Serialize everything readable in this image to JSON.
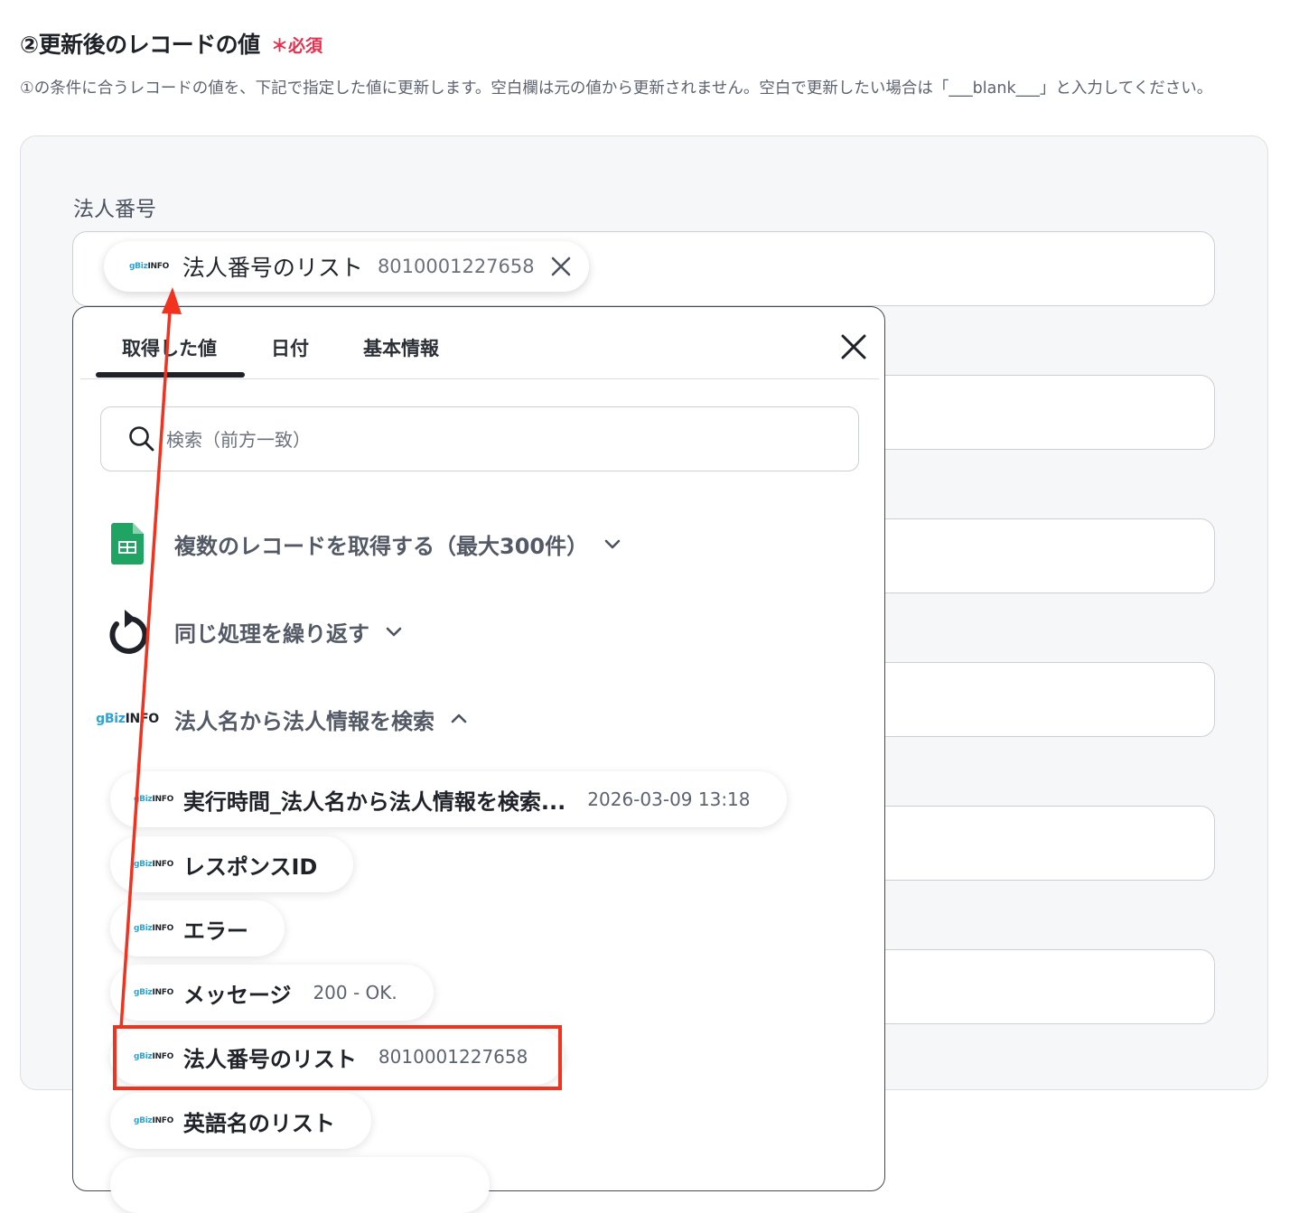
{
  "header": {
    "title": "②更新後のレコードの値",
    "required": "＊必須",
    "description": "①の条件に合うレコードの値を、下記で指定した値に更新します。空白欄は元の値から更新されません。空白で更新したい場合は「___blank___」と入力してください。"
  },
  "field": {
    "label": "法人番号",
    "chip_name": "法人番号のリスト",
    "chip_value": "8010001227658"
  },
  "panel": {
    "tabs": [
      "取得した値",
      "日付",
      "基本情報"
    ],
    "search_placeholder": "検索（前方一致）",
    "groups": [
      {
        "label": "複数のレコードを取得する（最大300件）",
        "icon": "google-sheets-icon",
        "expanded": false
      },
      {
        "label": "同じ処理を繰り返す",
        "icon": "repeat-icon",
        "expanded": false
      },
      {
        "label": "法人名から法人情報を検索",
        "icon": "gbizinfo-logo",
        "expanded": true
      }
    ],
    "items": [
      {
        "name": "実行時間_法人名から法人情報を検索...",
        "value": "2026-03-09 13:18"
      },
      {
        "name": "レスポンスID",
        "value": ""
      },
      {
        "name": "エラー",
        "value": ""
      },
      {
        "name": "メッセージ",
        "value": "200 - OK."
      },
      {
        "name": "法人番号のリスト",
        "value": "8010001227658"
      },
      {
        "name": "英語名のリスト",
        "value": ""
      }
    ]
  },
  "logo": {
    "part1": "gBiz",
    "part2": "INFO"
  },
  "colors": {
    "required": "#e5304e",
    "annotation": "#f0321f",
    "sheets_green": "#1fa463"
  }
}
